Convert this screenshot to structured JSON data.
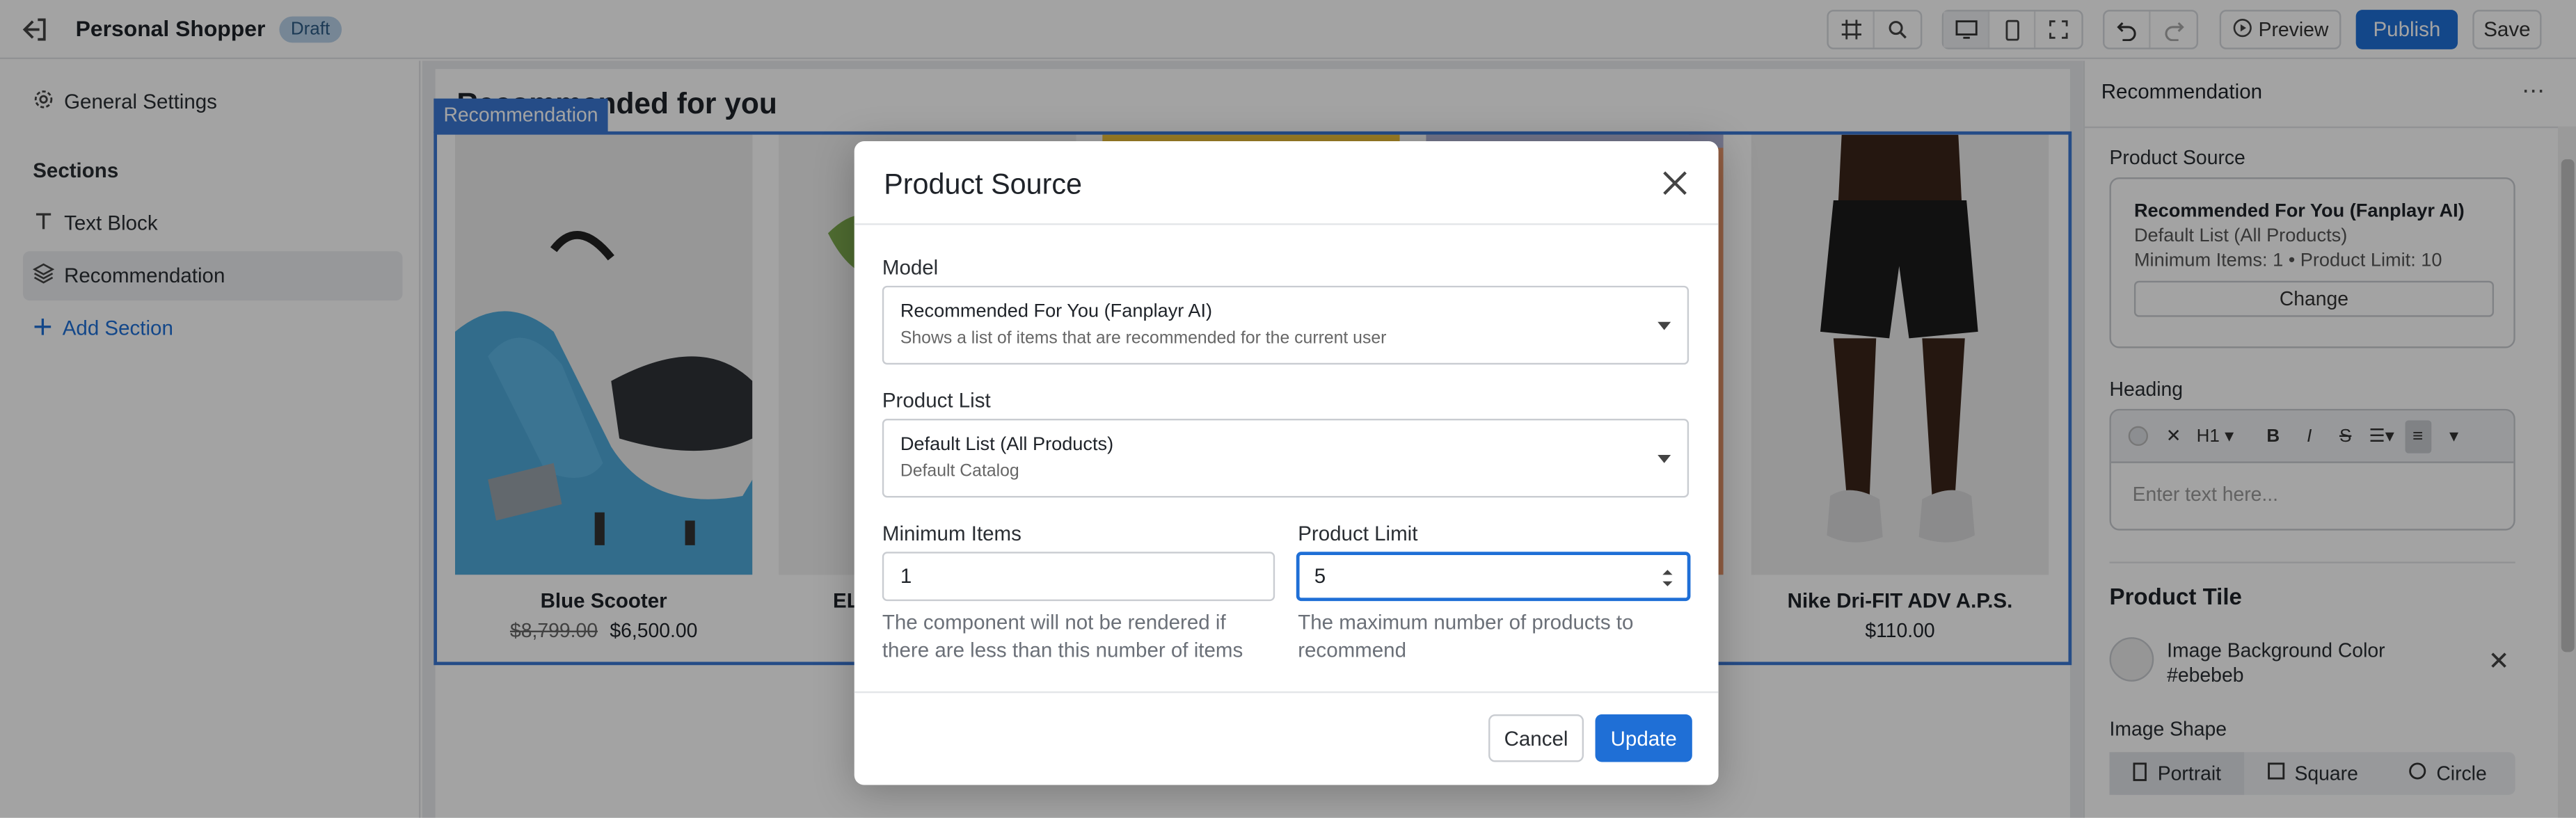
{
  "header": {
    "app_title": "Personal Shopper",
    "status_badge": "Draft",
    "preview_label": "Preview",
    "publish_label": "Publish",
    "save_label": "Save"
  },
  "sidebar": {
    "general_settings": "General Settings",
    "sections_heading": "Sections",
    "items": [
      {
        "label": "Text Block",
        "icon": "text-icon"
      },
      {
        "label": "Recommendation",
        "icon": "layers-icon",
        "active": true
      }
    ],
    "add_section": "Add Section"
  },
  "canvas": {
    "heading": "Recommended for you",
    "selection_tag": "Recommendation",
    "products": [
      {
        "name": "Blue Scooter",
        "old_price": "$8,799.00",
        "price": "$6,500.00"
      },
      {
        "name": "EL",
        "old_price": "",
        "price": ""
      },
      {
        "name": "",
        "old_price": "",
        "price": ""
      },
      {
        "name": "",
        "old_price": "",
        "price": ""
      },
      {
        "name": "Nike Dri-FIT ADV A.P.S.",
        "old_price": "",
        "price": "$110.00"
      }
    ]
  },
  "right_panel": {
    "title": "Recommendation",
    "product_source_label": "Product Source",
    "source_card": {
      "model": "Recommended For You (Fanplayr AI)",
      "list": "Default List (All Products)",
      "summary": "Minimum Items: 1 • Product Limit: 10",
      "change_label": "Change"
    },
    "heading_label": "Heading",
    "editor": {
      "heading_level": "H1",
      "placeholder": "Enter text here..."
    },
    "product_tile_title": "Product Tile",
    "image_bg_label": "Image Background Color",
    "image_bg_value": "#ebebeb",
    "image_shape_label": "Image Shape",
    "shapes": [
      {
        "label": "Portrait",
        "active": true
      },
      {
        "label": "Square",
        "active": false
      },
      {
        "label": "Circle",
        "active": false
      }
    ]
  },
  "modal": {
    "title": "Product Source",
    "model_label": "Model",
    "model_value": "Recommended For You (Fanplayr AI)",
    "model_desc": "Shows a list of items that are recommended for the current user",
    "list_label": "Product List",
    "list_value": "Default List (All Products)",
    "list_desc": "Default Catalog",
    "min_items_label": "Minimum Items",
    "min_items_value": "1",
    "min_items_help": "The component will not be rendered if there are less than this number of items",
    "limit_label": "Product Limit",
    "limit_value": "5",
    "limit_help": "The maximum number of products to recommend",
    "cancel_label": "Cancel",
    "update_label": "Update"
  },
  "colors": {
    "accent": "#1f6fd6",
    "selection": "#3b78d4",
    "badge_bg": "#b9d2ea"
  }
}
